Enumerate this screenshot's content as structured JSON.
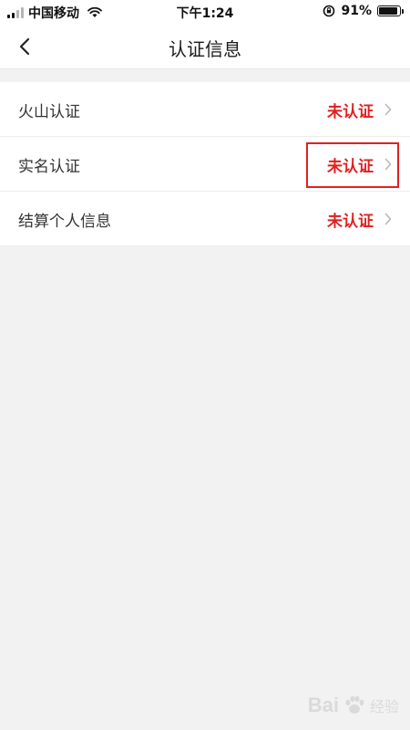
{
  "status_bar": {
    "carrier": "中国移动",
    "time": "下午1:24",
    "battery_text": "91%",
    "battery_level": 0.91
  },
  "nav": {
    "title": "认证信息"
  },
  "list": {
    "items": [
      {
        "label": "火山认证",
        "status": "未认证"
      },
      {
        "label": "实名认证",
        "status": "未认证"
      },
      {
        "label": "结算个人信息",
        "status": "未认证"
      }
    ]
  },
  "colors": {
    "status_red": "#e02020",
    "page_bg": "#f2f2f2",
    "highlight": "#e22020"
  },
  "watermark": {
    "brand": "Bai",
    "brand_tail": "经验"
  }
}
